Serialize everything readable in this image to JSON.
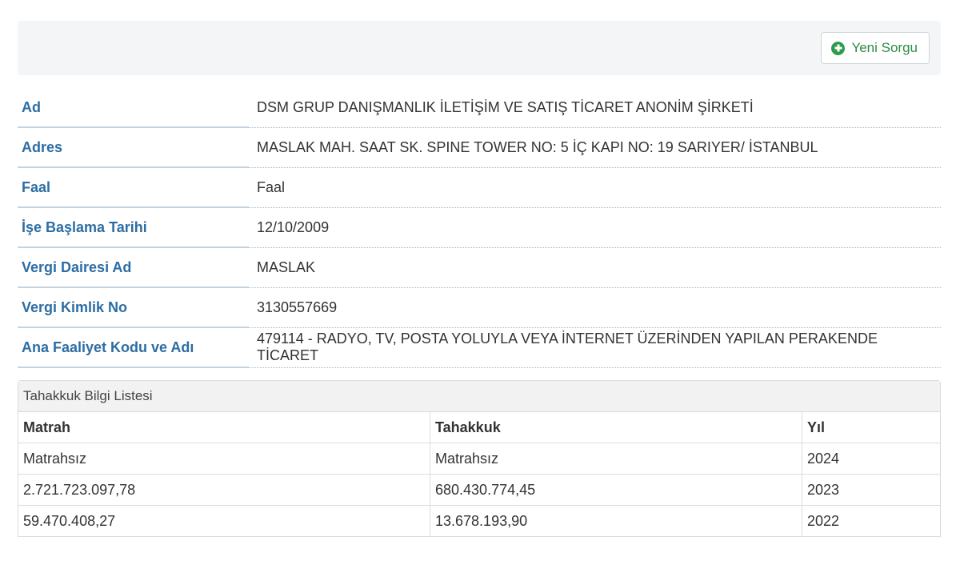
{
  "toolbar": {
    "new_query_label": "Yeni Sorgu"
  },
  "info": {
    "rows": [
      {
        "label": "Ad",
        "value": "DSM GRUP DANIŞMANLIK İLETİŞİM VE SATIŞ TİCARET ANONİM ŞİRKETİ"
      },
      {
        "label": "Adres",
        "value": "MASLAK MAH. SAAT SK. SPINE TOWER NO: 5 İÇ KAPI NO: 19 SARIYER/ İSTANBUL"
      },
      {
        "label": "Faal",
        "value": "Faal"
      },
      {
        "label": "İşe Başlama Tarihi",
        "value": "12/10/2009"
      },
      {
        "label": "Vergi Dairesi Ad",
        "value": "MASLAK"
      },
      {
        "label": "Vergi Kimlik No",
        "value": "3130557669"
      },
      {
        "label": "Ana Faaliyet Kodu ve Adı",
        "value": "479114 - RADYO, TV, POSTA YOLUYLA VEYA İNTERNET ÜZERİNDEN YAPILAN PERAKENDE TİCARET"
      }
    ]
  },
  "accruals": {
    "title": "Tahakkuk Bilgi Listesi",
    "columns": [
      "Matrah",
      "Tahakkuk",
      "Yıl"
    ],
    "rows": [
      [
        "Matrahsız",
        "Matrahsız",
        "2024"
      ],
      [
        "2.721.723.097,78",
        "680.430.774,45",
        "2023"
      ],
      [
        "59.470.408,27",
        "13.678.193,90",
        "2022"
      ]
    ]
  },
  "colors": {
    "label_blue": "#2d6da3",
    "button_green": "#2e8b45"
  },
  "icons": {
    "new_query": "plus-circle-icon"
  }
}
